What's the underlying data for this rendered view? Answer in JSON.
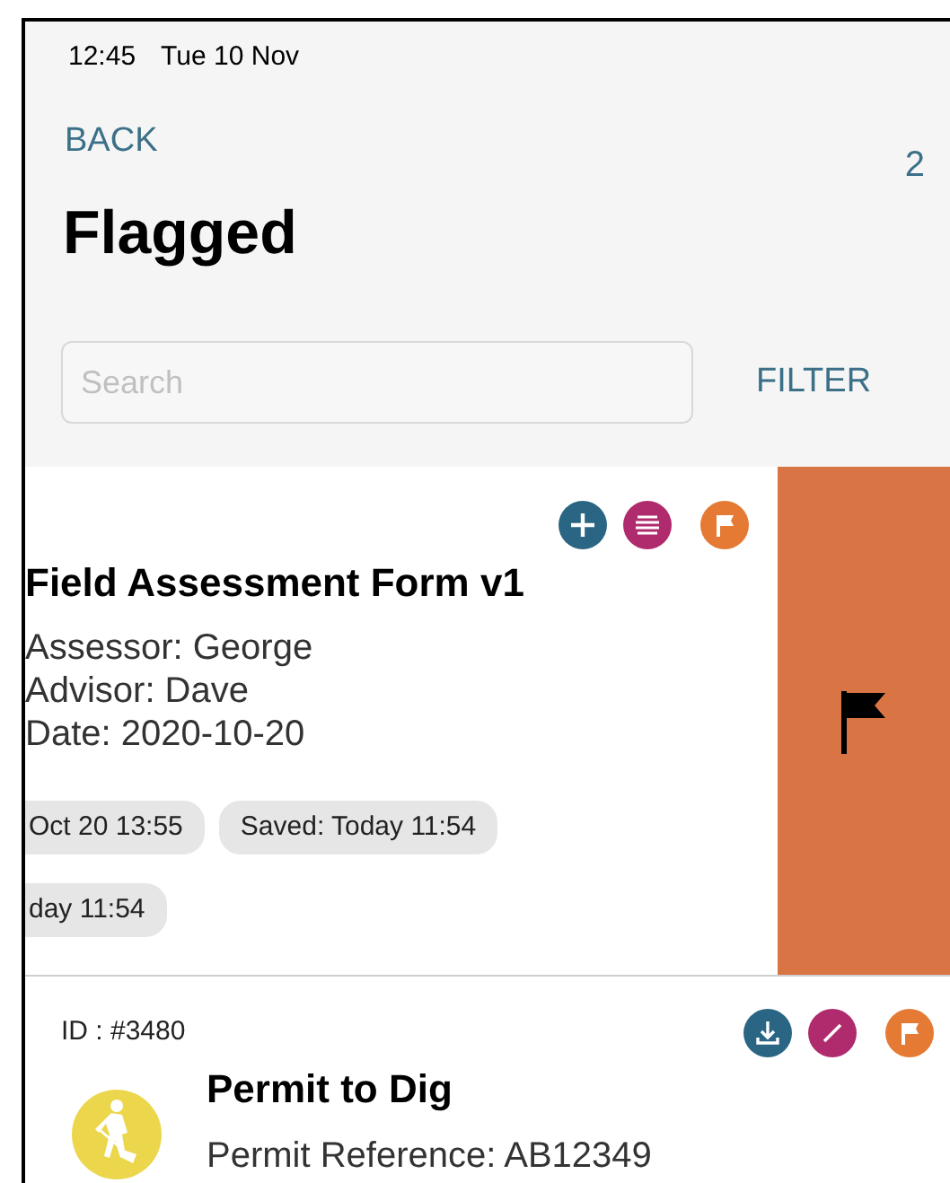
{
  "status_bar": {
    "time": "12:45",
    "date": "Tue 10 Nov"
  },
  "nav": {
    "back": "BACK",
    "count": "2"
  },
  "title": "Flagged",
  "search": {
    "placeholder": "Search"
  },
  "filter": "FILTER",
  "items": [
    {
      "swiped": true,
      "swipe_action": {
        "kind": "flag"
      },
      "actions": [
        {
          "kind": "add"
        },
        {
          "kind": "list"
        },
        {
          "kind": "flag"
        }
      ],
      "title": "Field Assessment Form v1",
      "details": [
        "Assessor: George",
        "Advisor: Dave",
        "Date: 2020-10-20"
      ],
      "chips": [
        "Oct 20 13:55",
        "Saved: Today 11:54",
        "day 11:54"
      ]
    },
    {
      "swiped": false,
      "id": "ID : #3480",
      "actions": [
        {
          "kind": "download"
        },
        {
          "kind": "edit"
        },
        {
          "kind": "flag"
        }
      ],
      "avatar": {
        "kind": "digger"
      },
      "title": "Permit to Dig",
      "details": [
        "Permit Reference: AB12349"
      ]
    }
  ]
}
